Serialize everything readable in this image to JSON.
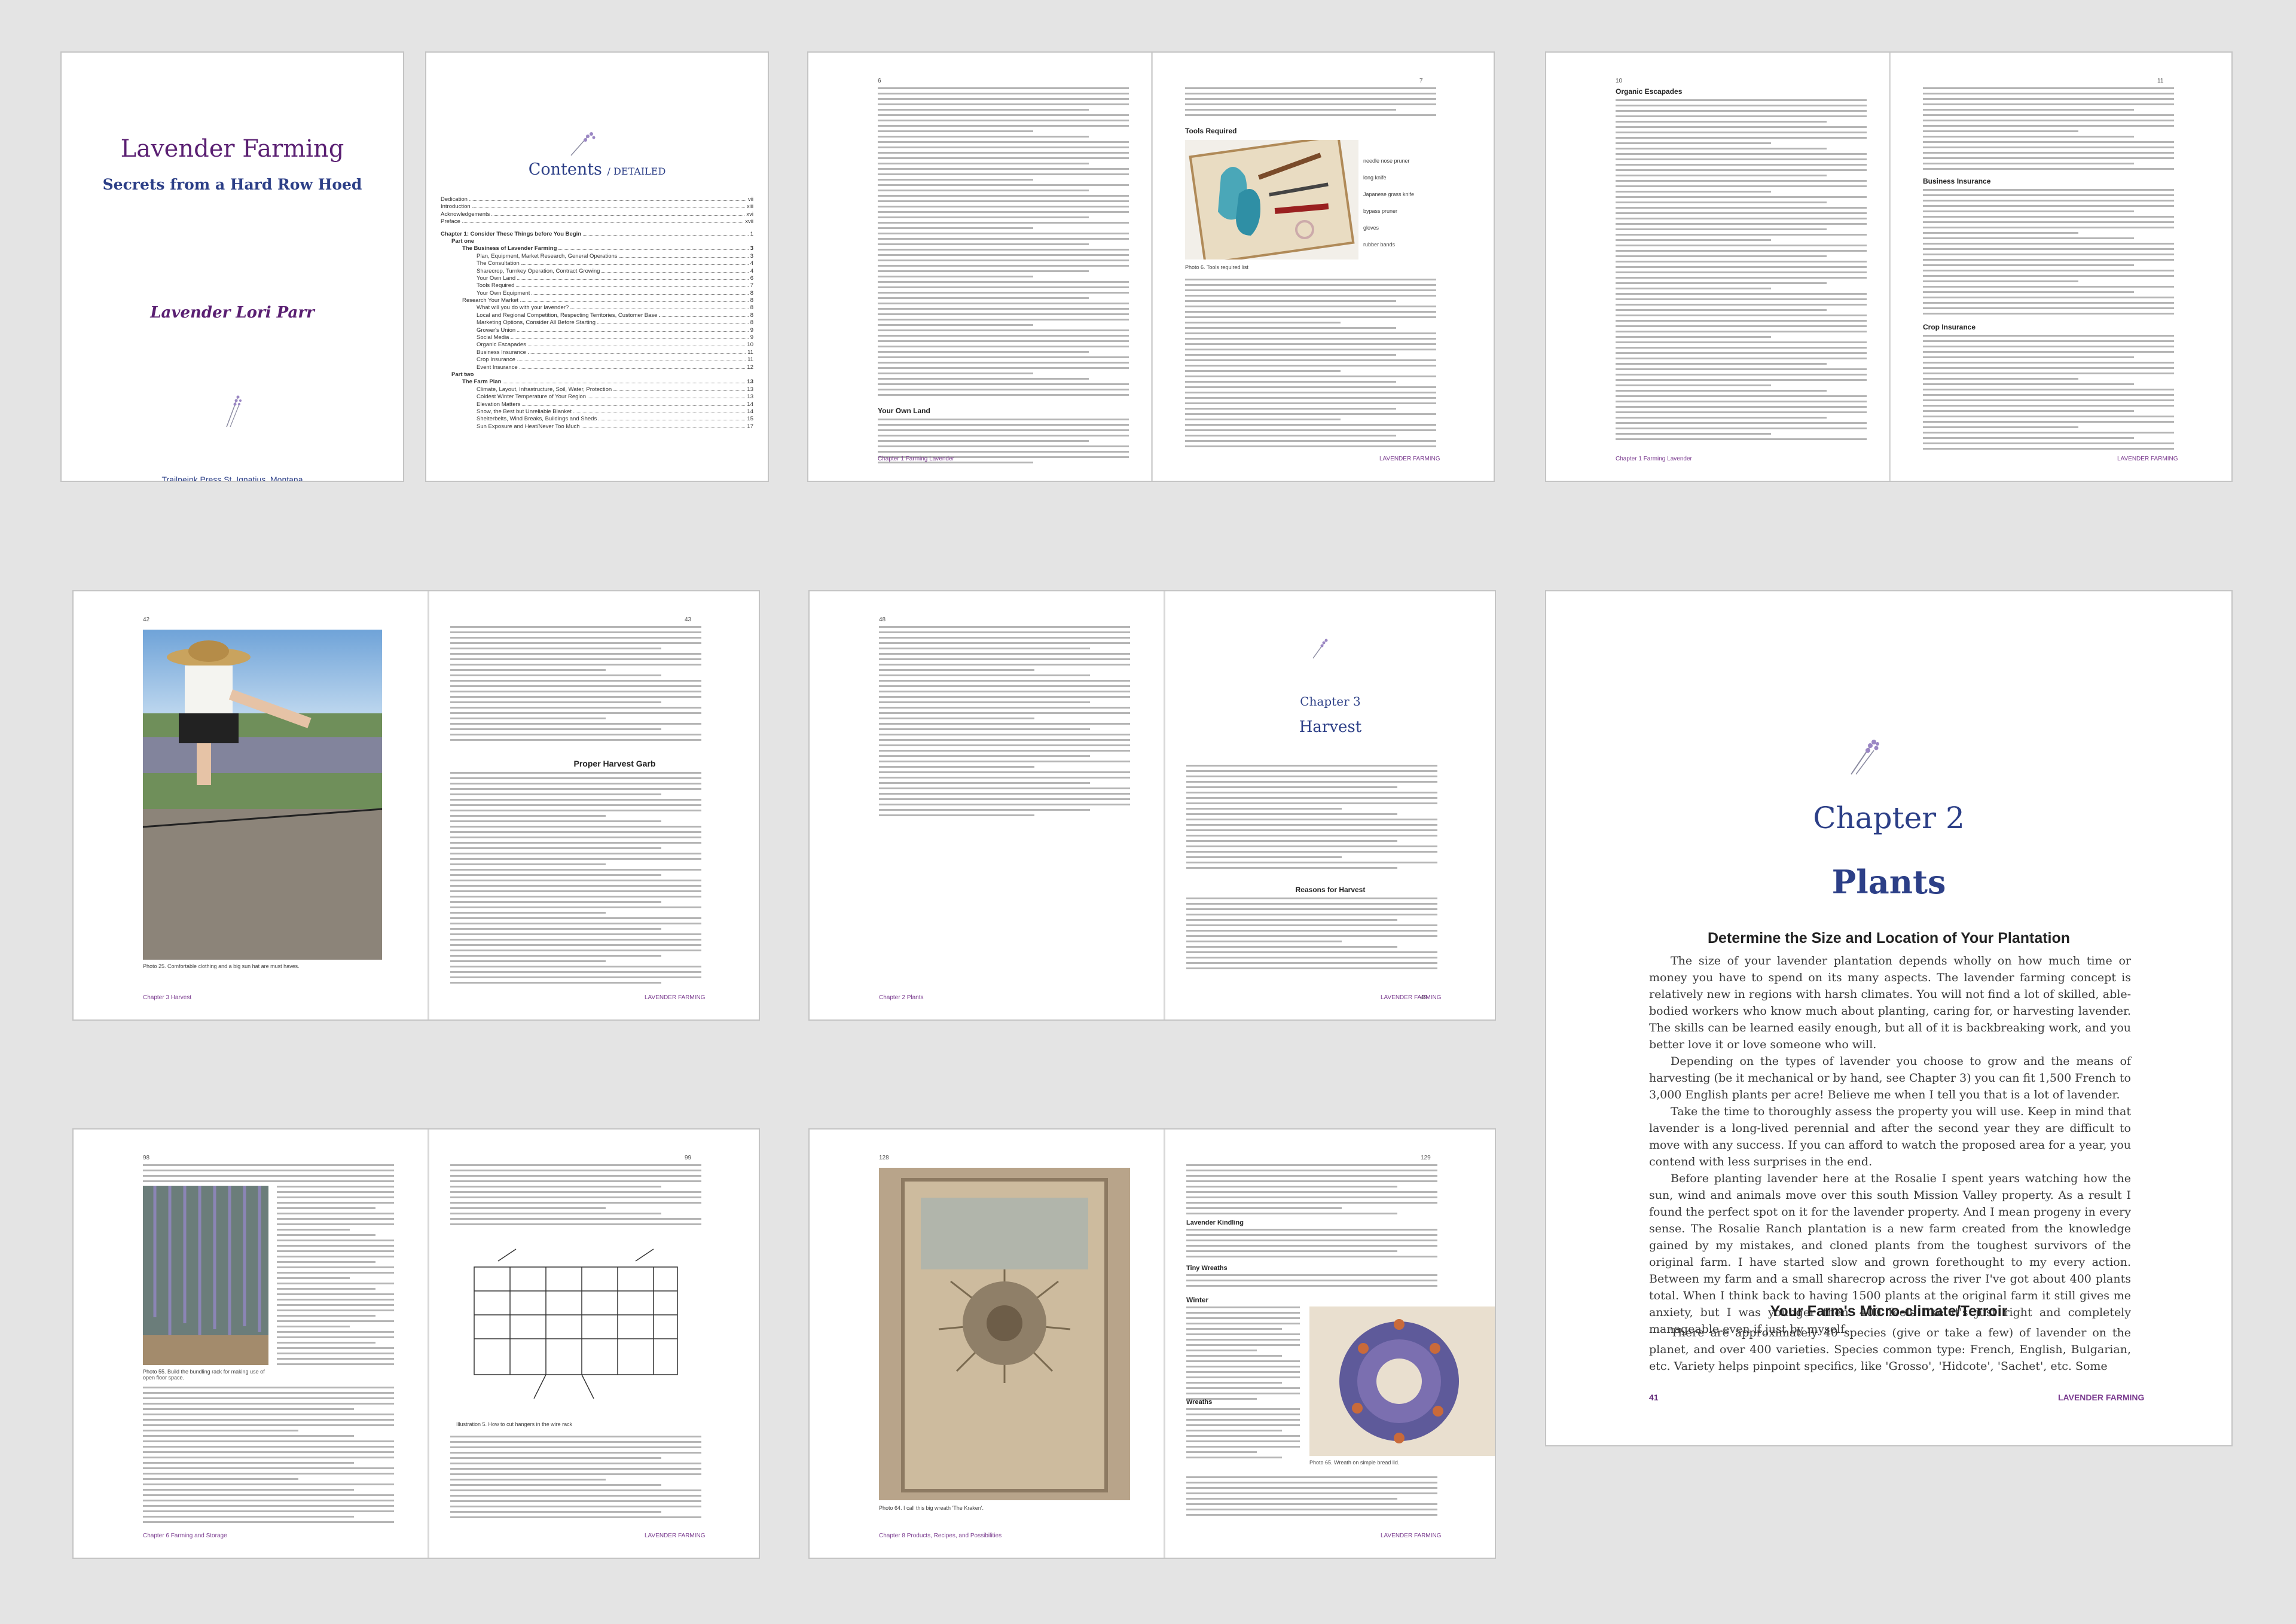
{
  "book": {
    "title": "Lavender Farming",
    "subtitle": "Secrets from a Hard Row Hoed",
    "author": "Lavender Lori Parr",
    "publisher": "Trailpeink Press St. Ignatius, Montana",
    "footer_brand": "LAVENDER FARMING"
  },
  "toc": {
    "title": "Contents",
    "title_suffix": "/ DETAILED",
    "entries": [
      {
        "t": "Dedication",
        "p": "vii"
      },
      {
        "t": "Introduction",
        "p": "xiii"
      },
      {
        "t": "Acknowledgements",
        "p": "xvi"
      },
      {
        "t": "Preface",
        "p": "xvii"
      },
      {
        "t": "Chapter 1: Consider These Things before You Begin",
        "p": "1"
      },
      {
        "t": "Part one",
        "p": ""
      },
      {
        "t": "The Business of Lavender Farming",
        "p": "3"
      },
      {
        "t": "Plan, Equipment, Market Research, General Operations",
        "p": "3"
      },
      {
        "t": "The Consultation",
        "p": "4"
      },
      {
        "t": "Sharecrop, Turnkey Operation, Contract Growing",
        "p": "4"
      },
      {
        "t": "Your Own Land",
        "p": "6"
      },
      {
        "t": "Tools Required",
        "p": "7"
      },
      {
        "t": "Your Own Equipment",
        "p": "8"
      },
      {
        "t": "Research Your Market",
        "p": "8"
      },
      {
        "t": "What will you do with your lavender?",
        "p": "8"
      },
      {
        "t": "Local and Regional Competition, Respecting Territories, Customer Base",
        "p": "8"
      },
      {
        "t": "Marketing Options, Consider All Before Starting",
        "p": "8"
      },
      {
        "t": "Grower's Union",
        "p": "9"
      },
      {
        "t": "Social Media",
        "p": "9"
      },
      {
        "t": "Organic Escapades",
        "p": "10"
      },
      {
        "t": "Business Insurance",
        "p": "11"
      },
      {
        "t": "Crop Insurance",
        "p": "11"
      },
      {
        "t": "Event Insurance",
        "p": "12"
      },
      {
        "t": "Part two",
        "p": ""
      },
      {
        "t": "The Farm Plan",
        "p": "13"
      },
      {
        "t": "Climate, Layout, Infrastructure, Soil, Water, Protection",
        "p": "13"
      },
      {
        "t": "Coldest Winter Temperature of Your Region",
        "p": "13"
      },
      {
        "t": "Elevation Matters",
        "p": "14"
      },
      {
        "t": "Snow, the Best but Unreliable Blanket",
        "p": "14"
      },
      {
        "t": "Shelterbelts, Wind Breaks, Buildings and Sheds",
        "p": "15"
      },
      {
        "t": "Sun Exposure and Heat/Never Too Much",
        "p": "17"
      }
    ]
  },
  "spreads": {
    "s_6_7": {
      "left_num": "6",
      "right_num": "7",
      "heading_right": "Tools Required",
      "heading_left": "Your Own Land",
      "caption": "Photo 6. Tools required list",
      "footer_left": "Chapter 1 Farming Lavender",
      "callouts": [
        "needle nose pruner",
        "long knife",
        "Japanese grass knife",
        "bypass pruner",
        "gloves",
        "rubber bands"
      ]
    },
    "s_10_11": {
      "left_num": "10",
      "right_num": "11",
      "heading_left": "Organic Escapades",
      "heading_right_1": "Business Insurance",
      "heading_right_2": "Crop Insurance",
      "footer_left": "Chapter 1 Farming Lavender"
    },
    "s_42_43": {
      "left_num": "42",
      "right_num": "43",
      "heading": "Proper Harvest Garb",
      "caption": "Photo 25. Comfortable clothing and a big sun hat are must haves.",
      "footer_left": "Chapter 3 Harvest"
    },
    "s_48_49": {
      "left_num": "48",
      "right_num": "49",
      "chapter_label": "Chapter 3",
      "chapter_name": "Harvest",
      "heading": "Reasons for Harvest",
      "footer_left": "Chapter 2 Plants"
    },
    "s_98_99": {
      "left_num": "98",
      "right_num": "99",
      "caption_left": "Photo 55. Build the bundling rack for making use of open floor space.",
      "caption_right": "Illustration 5. How to cut hangers in the wire rack",
      "footer_left": "Chapter 6 Farming and Storage"
    },
    "s_128_129": {
      "left_num": "128",
      "right_num": "129",
      "headings": [
        "Lavender Kindling",
        "Tiny Wreaths",
        "Winter",
        "Wreaths"
      ],
      "caption_left": "Photo 64. I call this big wreath 'The Kraken'.",
      "caption_right": "Photo 65. Wreath on simple bread lid.",
      "footer_left": "Chapter 8 Products, Recipes, and Possibilities"
    }
  },
  "chapter2": {
    "label": "Chapter 2",
    "name": "Plants",
    "section1": "Determine the Size and Location of Your Plantation",
    "para1": "The size of your lavender plantation depends wholly on how much time or money you have to spend on its many aspects. The lavender farming concept is relatively new in regions with harsh climates. You will not find a lot of skilled, able-bodied workers who know much about planting, caring for, or harvesting lavender. The skills can be learned easily enough, but all of it is backbreaking work, and you better love it or love someone who will.",
    "para2": "Depending on the types of lavender you choose to grow and the means of harvesting (be it mechanical or by hand, see Chapter 3) you can fit 1,500 French to 3,000 English plants per acre! Believe me when I tell you that is a lot of lavender.",
    "para3": "Take the time to thoroughly assess the property you will use. Keep in mind that lavender is a long-lived perennial and after the second year they are difficult to move with any success. If you can afford to watch the proposed area for a year, you contend with less surprises in the end.",
    "para4": "Before planting lavender here at the Rosalie I spent years watching how the sun, wind and animals move over this south Mission Valley property. As a result I found the perfect spot on it for the lavender property. And I mean progeny in every sense. The Rosalie Ranch plantation is a new farm created from the knowledge gained by my mistakes, and cloned plants from the toughest survivors of the original farm. I have started slow and grown forethought to my every action. Between my farm and a small sharecrop across the river I've got about 400 plants total. When I think back to having 1500 plants at the original farm it still gives me anxiety, but I was younger then. 400 feels like it's just right and completely manageable even if just by myself.",
    "section2": "Your Farm's Micro-climate/Terroir",
    "para5": "There are approximately 40 species (give or take a few) of lavender on the planet, and over 400 varieties. Species common type: French, English, Bulgarian, etc. Variety helps pinpoint specifics, like 'Grosso', 'Hidcote', 'Sachet', etc. Some",
    "page_num": "41"
  },
  "colors": {
    "purple": "#5a1f72",
    "navy": "#2c3f87",
    "page_bg": "#ffffff",
    "canvas_bg": "#e4e4e4"
  }
}
